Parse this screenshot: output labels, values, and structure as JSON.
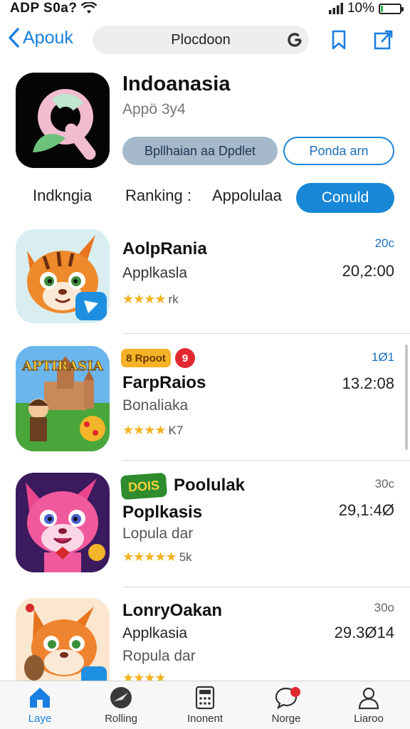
{
  "status_bar": {
    "carrier": "ADP S0a?",
    "battery_text": "10%",
    "battery_level": 0.1,
    "icons": [
      "wifi-icon",
      "signal-icon",
      "battery-icon"
    ]
  },
  "nav": {
    "back_label": "Apouk",
    "search_text": "Plocdoon",
    "icons": [
      "chevron-left-icon",
      "google-g-icon",
      "bookmark-icon",
      "share-icon"
    ]
  },
  "featured": {
    "title": "Indoanasia",
    "subtitle": "Appö 3y4",
    "primary_button": "Bpllhaian aa Dpdlet",
    "secondary_button": "Ponda arn"
  },
  "tabs": {
    "items": [
      "Indkngia",
      "Ranking :",
      "Appolulaa"
    ],
    "active": "Conuld"
  },
  "apps": [
    {
      "title": "AolpRania",
      "subtitle": "Applkasla",
      "rating_count": "rk",
      "rank": "20c",
      "number": "20,2:00",
      "icon": "orange-cat-icon"
    },
    {
      "badge": "8 Rpoot",
      "red_badge": "9",
      "title": "FarpRaios",
      "subtitle": "Bonaliaka",
      "rating_count": "K7",
      "rank": "1Ø1",
      "number": "13.2:08",
      "icon_text": "APTIRASIA",
      "icon": "cathedral-game-icon"
    },
    {
      "logo_text": "DOIS",
      "title_inline": "Poolulak",
      "title": "Poplkasis",
      "subtitle": "Lopula dar",
      "rating_count": "5k",
      "rank": "30c",
      "number": "29,1:4Ø",
      "icon": "pink-cat-icon"
    },
    {
      "title": "LonryOakan",
      "subtitle": "Applkasia",
      "subtitle2": "Ropula dar",
      "rating_count": "",
      "rank": "30o",
      "number": "29.3Ø14",
      "icon": "fox-icon"
    }
  ],
  "tabbar": {
    "items": [
      {
        "label": "Laye",
        "icon": "home-icon"
      },
      {
        "label": "Rolling",
        "icon": "compass-icon"
      },
      {
        "label": "Inonent",
        "icon": "calculator-icon"
      },
      {
        "label": "Norge",
        "icon": "chat-icon"
      },
      {
        "label": "Liaroo",
        "icon": "person-icon"
      }
    ],
    "active": "Laye"
  },
  "colors": {
    "accent": "#1a7fe0",
    "star": "#f2b21f",
    "badge_red": "#e2282f"
  }
}
